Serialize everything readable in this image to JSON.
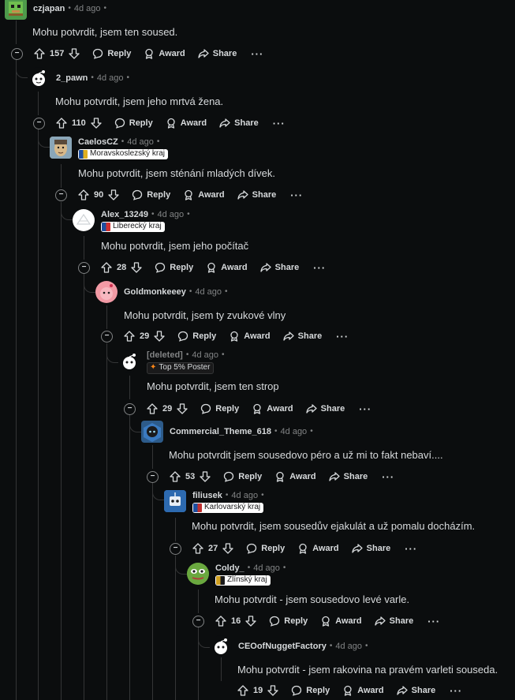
{
  "actions": {
    "reply": "Reply",
    "award": "Award",
    "share": "Share",
    "more": "···",
    "collapse": "−"
  },
  "comments": [
    {
      "author": "czjapan",
      "time": "4d ago",
      "body": "Mohu potvrdit, jsem ten soused.",
      "score": "157",
      "flair": "",
      "avatar_color": "#4e9a4b",
      "avatar_icon": "block-avatar-icon"
    },
    {
      "author": "2_pawn",
      "time": "4d ago",
      "body": "Mohu potvrdit, jsem jeho mrtvá žena.",
      "score": "110",
      "flair": "",
      "avatar_color": "#ffffff",
      "avatar_icon": "snoo-avatar-icon"
    },
    {
      "author": "CaelosCZ",
      "time": "4d ago",
      "body": "Mohu potvrdit, jsem sténání mladých dívek.",
      "score": "90",
      "flair": "Moravskoslezský kraj",
      "avatar_color": "#c9b48a",
      "avatar_icon": "face-avatar-icon"
    },
    {
      "author": "Alex_13249",
      "time": "4d ago",
      "body": "Mohu potvrdit, jsem jeho počítač",
      "score": "28",
      "flair": "Liberecký kraj",
      "avatar_color": "#ffffff",
      "avatar_icon": "snoo-avatar-icon"
    },
    {
      "author": "Goldmonkeeey",
      "time": "4d ago",
      "body": "Mohu potvrdit, jsem ty zvukové vlny",
      "score": "29",
      "flair": "",
      "avatar_color": "#f29aa5",
      "avatar_icon": "snoo-avatar-icon"
    },
    {
      "author": "[deleted]",
      "time": "4d ago",
      "body": "Mohu potvrdit, jsem ten strop",
      "score": "29",
      "flair": "Top 5% Poster",
      "avatar_color": "#1a1a1b",
      "avatar_icon": "snoo-avatar-icon"
    },
    {
      "author": "Commercial_Theme_618",
      "time": "4d ago",
      "body": "Mohu potvrdit jsem sousedovo péro a už mi to fakt nebaví....",
      "score": "53",
      "flair": "",
      "avatar_color": "#2d5b8a",
      "avatar_icon": "hooded-avatar-icon"
    },
    {
      "author": "filiusek",
      "time": "4d ago",
      "body": "Mohu potvrdit, jsem sousedův ejakulát a už pomalu docházím.",
      "score": "27",
      "flair": "Karlovarský kraj",
      "avatar_color": "#3a78c4",
      "avatar_icon": "robot-avatar-icon"
    },
    {
      "author": "Coldy_",
      "time": "4d ago",
      "body": "Mohu potvrdit - jsem sousedovo levé varle.",
      "score": "16",
      "flair": "Zlínský kraj",
      "avatar_color": "#5a9a3a",
      "avatar_icon": "frog-avatar-icon"
    },
    {
      "author": "CEOofNuggetFactory",
      "time": "4d ago",
      "body": "Mohu potvrdit - jsem rakovina na pravém varleti souseda.",
      "score": "19",
      "flair": "",
      "avatar_color": "#1a1a1b",
      "avatar_icon": "snoo-avatar-icon"
    }
  ]
}
